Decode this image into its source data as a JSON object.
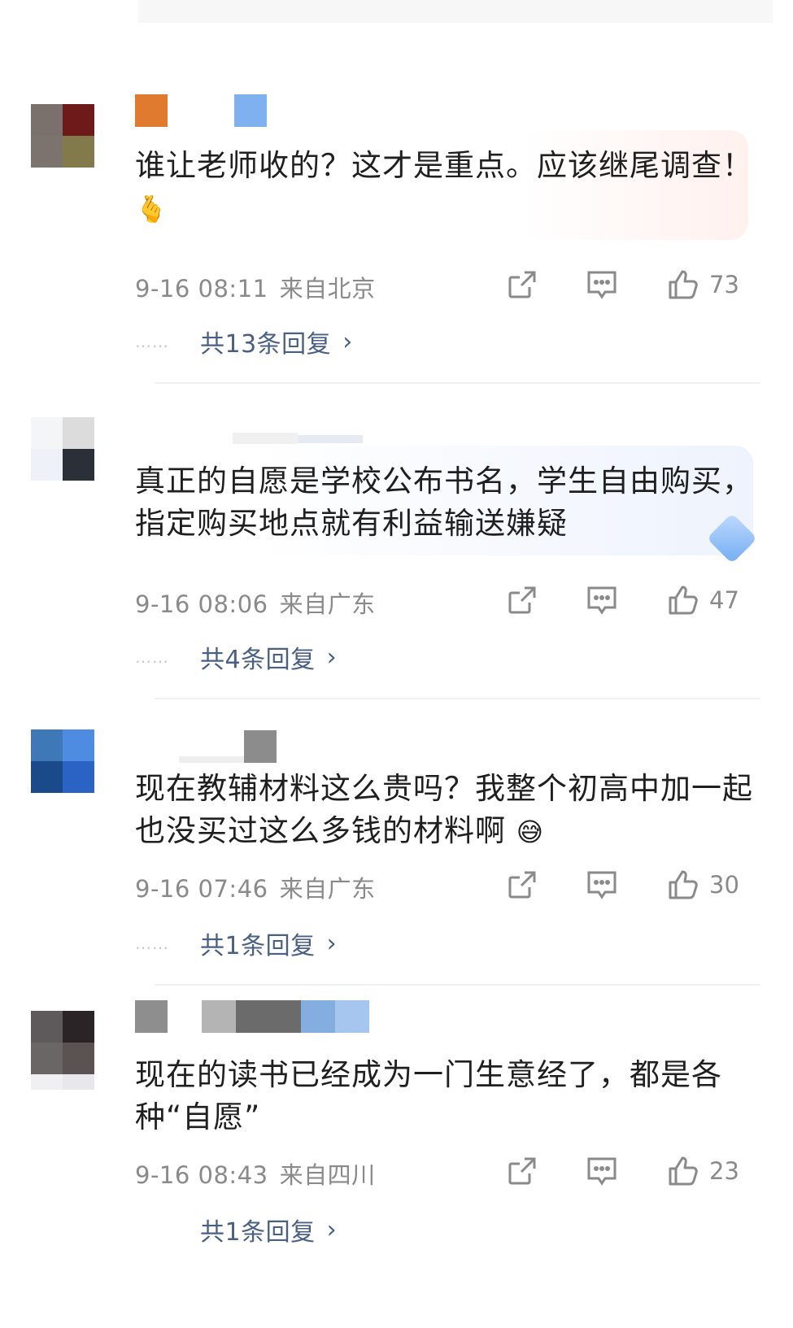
{
  "comments": [
    {
      "text": "谁让老师收的？这才是重点。应该继尾调查！",
      "emoji": "🫰",
      "time": "9-16 08:11",
      "location": "来自北京",
      "likes": "73",
      "replies": "共13条回复"
    },
    {
      "text": "真正的自愿是学校公布书名，学生自由购买，指定购买地点就有利益输送嫌疑",
      "emoji": "",
      "time": "9-16 08:06",
      "location": "来自广东",
      "likes": "47",
      "replies": "共4条回复"
    },
    {
      "text": "现在教辅材料这么贵吗？我整个初高中加一起也没买过这么多钱的材料啊",
      "emoji": "😅",
      "time": "9-16 07:46",
      "location": "来自广东",
      "likes": "30",
      "replies": "共1条回复"
    },
    {
      "text": "现在的读书已经成为一门生意经了，都是各种“自愿”",
      "emoji": "",
      "time": "9-16 08:43",
      "location": "来自四川",
      "likes": "23",
      "replies": "共1条回复"
    }
  ],
  "icons": {
    "share": "share-icon",
    "comment": "comment-icon",
    "like": "thumbs-up-icon",
    "chevron": "chevron-right-icon"
  },
  "colors": {
    "meta_gray": "#8a8a8a",
    "reply_link": "#4a5f84"
  },
  "dots": "……",
  "chevron_glyph": "›"
}
